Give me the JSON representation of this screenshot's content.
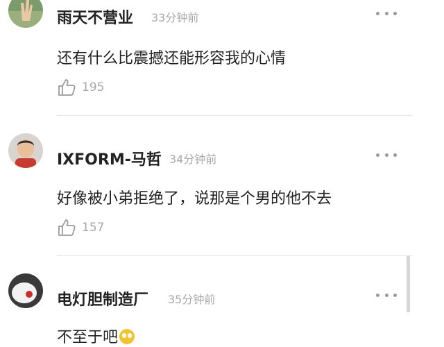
{
  "comments": [
    {
      "username": "雨天不营业",
      "time": "33分钟前",
      "text": "还有什么比震撼还能形容我的心情",
      "likes": "195",
      "avatar": "avatar-hand-icon"
    },
    {
      "username": "IXFORM-马哲",
      "time": "34分钟前",
      "text": "好像被小弟拒绝了，说那是个男的他不去",
      "likes": "157",
      "avatar": "avatar-child-icon"
    },
    {
      "username": "电灯胆制造厂",
      "time": "35分钟前",
      "text": "不至于吧",
      "avatar": "avatar-lightbulb-icon",
      "emoji": "fearful-face-icon"
    }
  ],
  "icons": {
    "more": "more-dots-icon",
    "like": "thumbs-up-icon"
  }
}
